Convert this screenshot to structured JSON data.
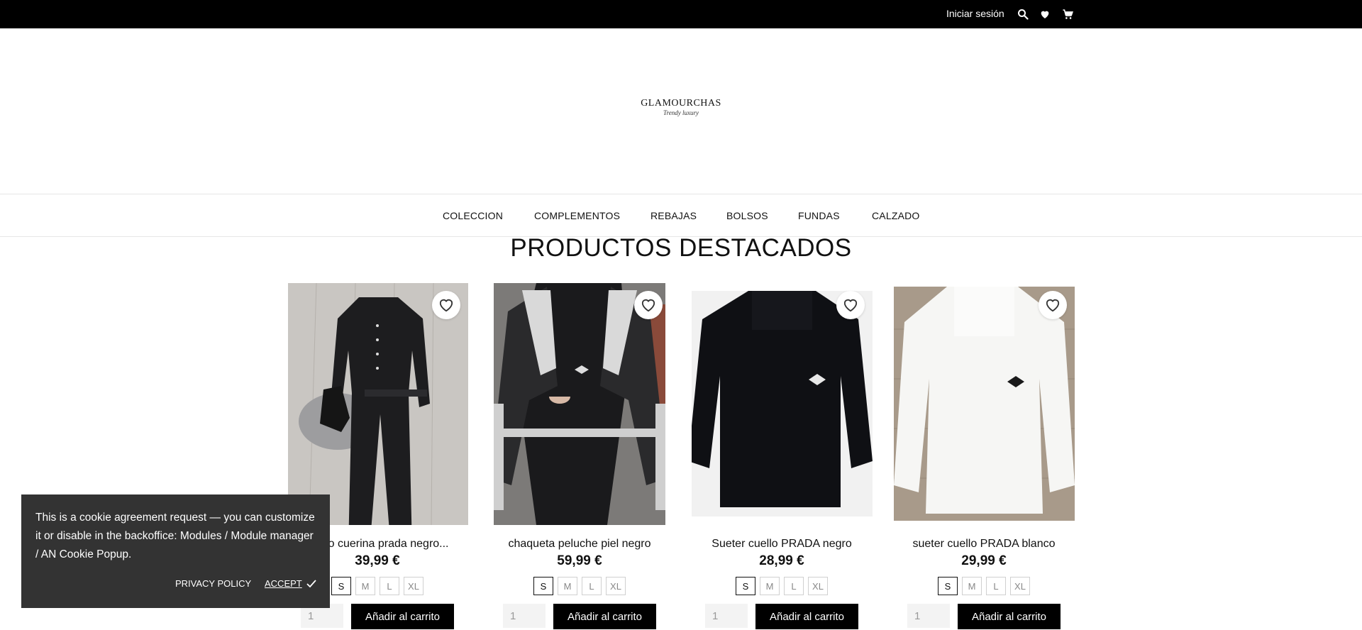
{
  "topbar": {
    "login_label": "Iniciar sesión",
    "icons": [
      "search-icon",
      "heart-icon",
      "cart-icon"
    ]
  },
  "logo": {
    "brand": "GLAMOURCHAS",
    "tagline": "Trendy luxury"
  },
  "nav": {
    "items": [
      "COLECCION",
      "COMPLEMENTOS",
      "REBAJAS",
      "BOLSOS",
      "FUNDAS",
      "CALZADO"
    ]
  },
  "section": {
    "title": "PRODUCTOS DESTACADOS"
  },
  "products": [
    {
      "name": "mono cuerina prada negro...",
      "price": "39,99 €",
      "sizes": [
        "S",
        "M",
        "L",
        "XL"
      ],
      "selected_size": "S",
      "qty": "1",
      "add_label": "Añadir al carrito"
    },
    {
      "name": "chaqueta peluche piel negro",
      "price": "59,99 €",
      "sizes": [
        "S",
        "M",
        "L",
        "XL"
      ],
      "selected_size": "S",
      "qty": "1",
      "add_label": "Añadir al carrito"
    },
    {
      "name": "Sueter cuello PRADA negro",
      "price": "28,99 €",
      "sizes": [
        "S",
        "M",
        "L",
        "XL"
      ],
      "selected_size": "S",
      "qty": "1",
      "add_label": "Añadir al carrito"
    },
    {
      "name": "sueter cuello PRADA blanco",
      "price": "29,99 €",
      "sizes": [
        "S",
        "M",
        "L",
        "XL"
      ],
      "selected_size": "S",
      "qty": "1",
      "add_label": "Añadir al carrito"
    }
  ],
  "cookie": {
    "text": "This is a cookie agreement request — you can customize it or disable in the backoffice: Modules / Module manager / AN Cookie Popup.",
    "policy_label": "PRIVACY POLICY",
    "accept_label": "ACCEPT"
  },
  "colors": {
    "topbar_bg": "#000000",
    "button_bg": "#000000",
    "cookie_bg": "#333333"
  }
}
